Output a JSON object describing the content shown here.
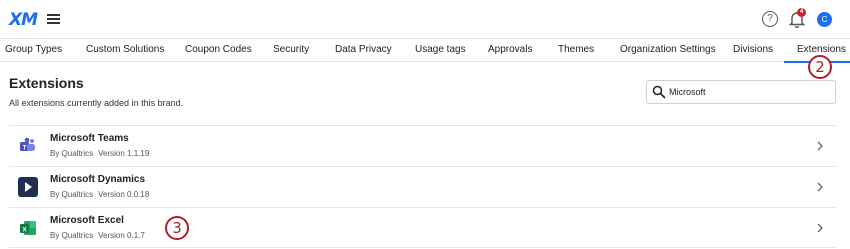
{
  "header": {
    "logo_text": "XM",
    "notification_count": "4",
    "avatar_initial": "C",
    "help_glyph": "?"
  },
  "tabs": [
    {
      "label": "Group Types"
    },
    {
      "label": "Custom Solutions"
    },
    {
      "label": "Coupon Codes"
    },
    {
      "label": "Security"
    },
    {
      "label": "Data Privacy"
    },
    {
      "label": "Usage tags"
    },
    {
      "label": "Approvals"
    },
    {
      "label": "Themes"
    },
    {
      "label": "Organization Settings"
    },
    {
      "label": "Divisions"
    },
    {
      "label": "Extensions",
      "active": true
    }
  ],
  "page": {
    "title": "Extensions",
    "subtitle": "All extensions currently added in this brand."
  },
  "search": {
    "value": "Microsoft"
  },
  "extensions": [
    {
      "name": "Microsoft Teams",
      "by": "By Qualtrics",
      "version": "Version 1.1.19",
      "icon": "teams-icon"
    },
    {
      "name": "Microsoft Dynamics",
      "by": "By Qualtrics",
      "version": "Version 0.0.18",
      "icon": "dynamics-icon"
    },
    {
      "name": "Microsoft Excel",
      "by": "By Qualtrics",
      "version": "Version 0.1.7",
      "icon": "excel-icon"
    }
  ],
  "callouts": [
    "2",
    "3"
  ],
  "colors": {
    "accent": "#1a6ef5",
    "callout": "#b01e2e",
    "badge": "#d12020"
  }
}
